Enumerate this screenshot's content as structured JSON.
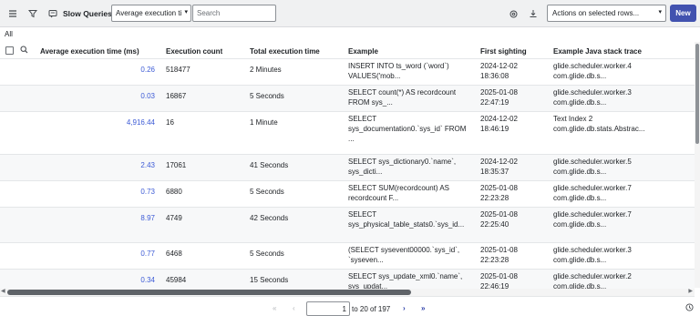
{
  "toolbar": {
    "title": "Slow Queries",
    "search_field_select": "Average execution ti",
    "search_placeholder": "Search",
    "actions_select": "Actions on selected rows...",
    "new_label": "New"
  },
  "breadcrumb": "All",
  "columns": [
    "Average execution time (ms)",
    "Execution count",
    "Total execution time",
    "Example",
    "First sighting",
    "Example Java stack trace"
  ],
  "rows": [
    {
      "avg": "0.26",
      "count": "518477",
      "total": "2 Minutes",
      "example": [
        "INSERT INTO ts_word (`word`)",
        "VALUES('mob..."
      ],
      "first": [
        "2024-12-02",
        "18:36:08"
      ],
      "stack": [
        "glide.scheduler.worker.4",
        "com.glide.db.s..."
      ]
    },
    {
      "avg": "0.03",
      "count": "16867",
      "total": "5 Seconds",
      "example": [
        "SELECT count(*) AS recordcount",
        "FROM sys_..."
      ],
      "first": [
        "2025-01-08",
        "22:47:19"
      ],
      "stack": [
        "glide.scheduler.worker.3",
        "com.glide.db.s..."
      ]
    },
    {
      "avg": "4,916.44",
      "count": "16",
      "total": "1 Minute",
      "example": [
        "SELECT",
        "sys_documentation0.`sys_id` FROM",
        "..."
      ],
      "first": [
        "2024-12-02",
        "18:46:19"
      ],
      "stack": [
        "Text Index 2",
        "com.glide.db.stats.Abstrac..."
      ]
    },
    {
      "avg": "2.43",
      "count": "17061",
      "total": "41 Seconds",
      "example": [
        "SELECT sys_dictionary0.`name`,",
        "sys_dicti..."
      ],
      "first": [
        "2024-12-02",
        "18:35:37"
      ],
      "stack": [
        "glide.scheduler.worker.5",
        "com.glide.db.s..."
      ]
    },
    {
      "avg": "0.73",
      "count": "6880",
      "total": "5 Seconds",
      "example": [
        "SELECT SUM(recordcount) AS",
        "recordcount F..."
      ],
      "first": [
        "2025-01-08",
        "22:23:28"
      ],
      "stack": [
        "glide.scheduler.worker.7",
        "com.glide.db.s..."
      ]
    },
    {
      "avg": "8.97",
      "count": "4749",
      "total": "42 Seconds",
      "example": [
        "SELECT",
        "sys_physical_table_stats0.`sys_id..."
      ],
      "first": [
        "2025-01-08",
        "22:25:40"
      ],
      "stack": [
        "glide.scheduler.worker.7",
        "com.glide.db.s..."
      ]
    },
    {
      "avg": "0.77",
      "count": "6468",
      "total": "5 Seconds",
      "example": [
        "(SELECT sysevent00000.`sys_id`,",
        "`syseven..."
      ],
      "first": [
        "2025-01-08",
        "22:23:28"
      ],
      "stack": [
        "glide.scheduler.worker.3",
        "com.glide.db.s..."
      ]
    },
    {
      "avg": "0.34",
      "count": "45984",
      "total": "15 Seconds",
      "example": [
        "SELECT sys_update_xml0.`name`,",
        "sys_updat..."
      ],
      "first": [
        "2025-01-08",
        "22:46:19"
      ],
      "stack": [
        "glide.scheduler.worker.2",
        "com.glide.db.s..."
      ]
    }
  ],
  "pager": {
    "page_input": "1",
    "range_text": "to 20 of 197"
  },
  "colors": {
    "accent": "#4252af",
    "link": "#3d5bd6",
    "toolbar_bg": "#f0f1f2"
  }
}
